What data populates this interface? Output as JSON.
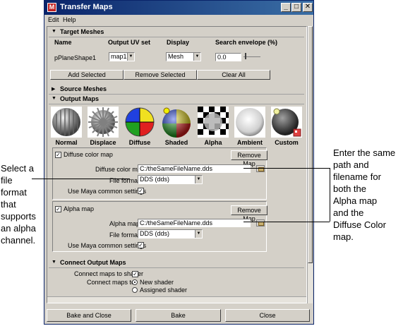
{
  "window": {
    "title": "Transfer Maps",
    "controls": [
      "_",
      "□",
      "✕"
    ]
  },
  "menu": [
    "Edit",
    "Help"
  ],
  "target_meshes": {
    "header": "Target Meshes",
    "columns": [
      "Name",
      "Output UV set",
      "Display",
      "Search envelope (%)"
    ],
    "row": {
      "name": "pPlaneShape1",
      "uv_set": "map1",
      "display": "Mesh",
      "search_envelope": "0.0"
    },
    "buttons": [
      "Add Selected",
      "Remove Selected",
      "Clear All"
    ]
  },
  "source_meshes": {
    "header": "Source Meshes"
  },
  "output_maps": {
    "header": "Output Maps",
    "tiles": [
      "Normal",
      "Displace",
      "Diffuse",
      "Shaded",
      "Alpha",
      "Ambient",
      "Custom"
    ],
    "diffuse": {
      "enable_label": "Diffuse color map",
      "remove_button": "Remove Map",
      "map_label": "Diffuse color map",
      "map_value": "C:/theSameFileName.dds",
      "format_label": "File format:",
      "format_value": "DDS (dds)",
      "common_label": "Use Maya common settings"
    },
    "alpha": {
      "enable_label": "Alpha map",
      "remove_button": "Remove Map",
      "map_label": "Alpha map",
      "map_value": "C:/theSameFileName.dds",
      "format_label": "File format:",
      "format_value": "DDS (dds)",
      "common_label": "Use Maya common settings"
    }
  },
  "connect_output_maps": {
    "header": "Connect Output Maps",
    "connect_label": "Connect maps to shader",
    "connect_to_label": "Connect maps to:",
    "options": [
      "New shader",
      "Assigned shader"
    ]
  },
  "bottom_buttons": [
    "Bake and Close",
    "Bake",
    "Close"
  ],
  "annotations": {
    "left": [
      "Select a",
      "file",
      "format",
      "that",
      "supports",
      "an alpha",
      "channel."
    ],
    "right": [
      "Enter the same",
      "path and",
      "filename for",
      "both the",
      "Alpha map",
      "and the",
      "Diffuse Color",
      "map."
    ]
  },
  "colors": {
    "titlebar": "#0a246a",
    "window_bg": "#d4d0c8"
  },
  "icons": [
    "maya-app-icon",
    "minimize-icon",
    "maximize-icon",
    "close-icon",
    "collapse-triangle-icon",
    "expand-triangle-icon",
    "folder-browse-icon"
  ]
}
